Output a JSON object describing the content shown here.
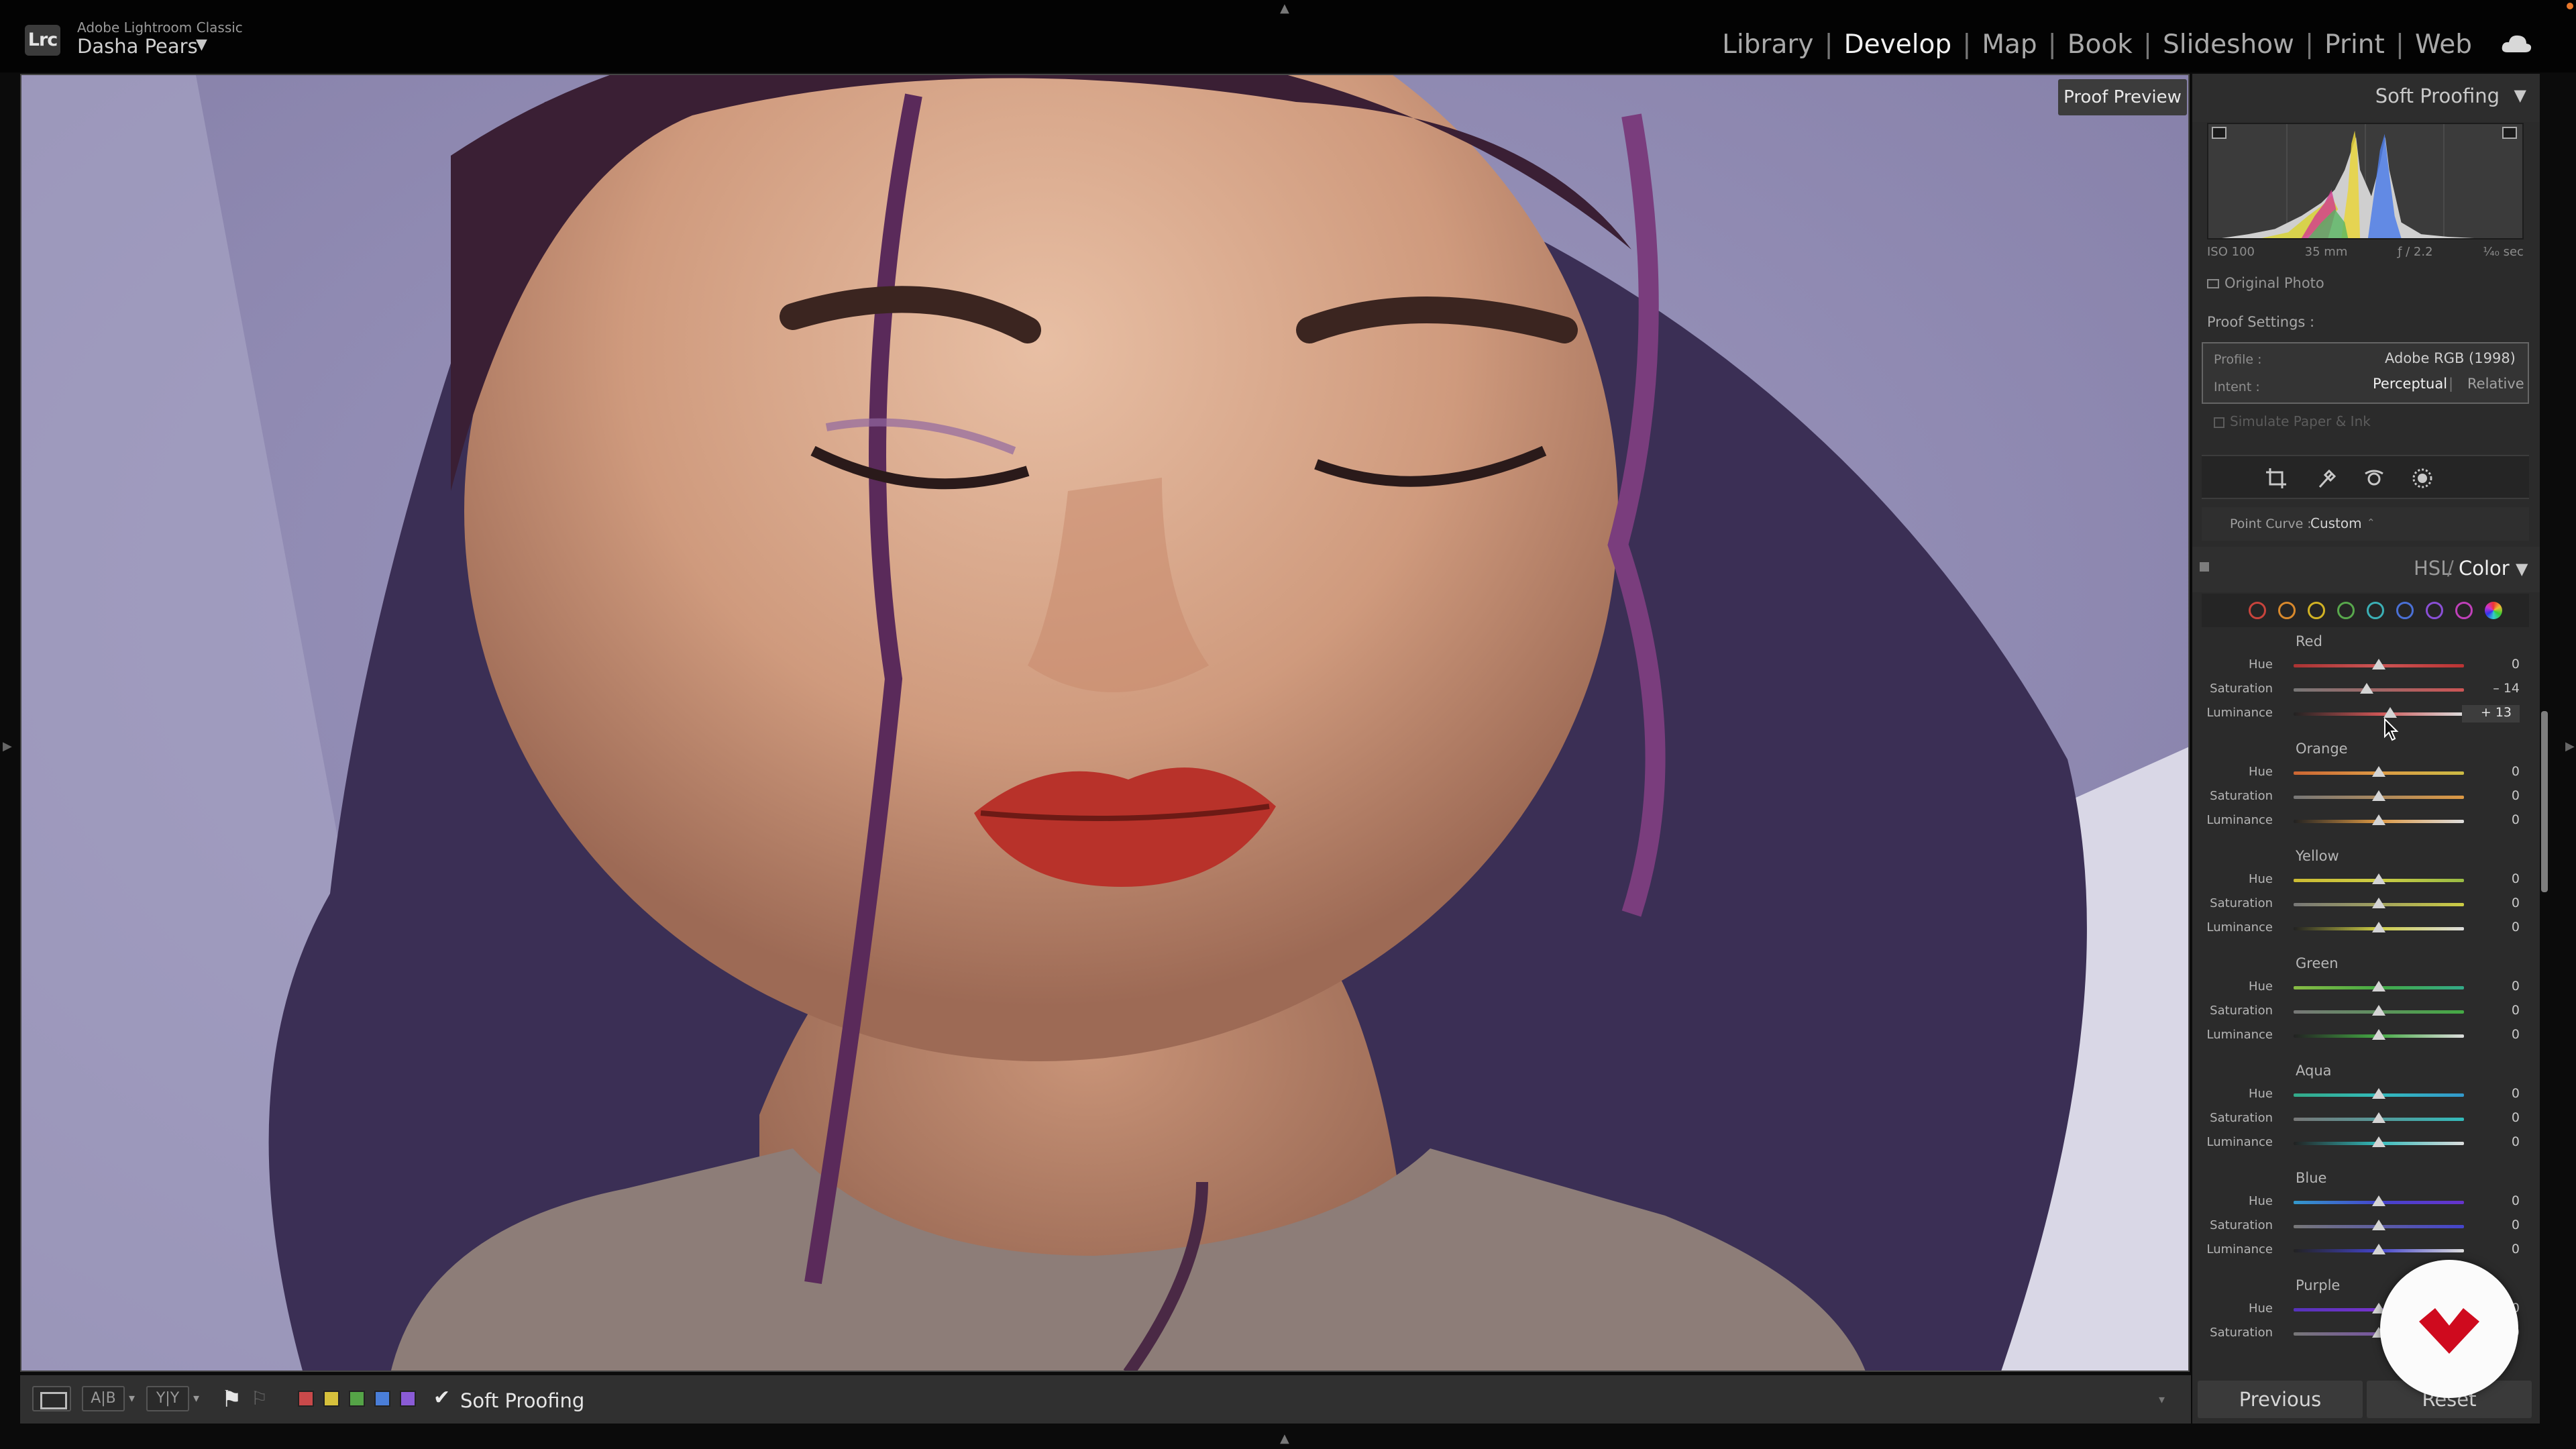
{
  "app": {
    "name": "Adobe Lightroom Classic",
    "logo_text": "Lrc",
    "user": "Dasha Pears",
    "user_arrow": "▼"
  },
  "modules": [
    "Library",
    "Develop",
    "Map",
    "Book",
    "Slideshow",
    "Print",
    "Web"
  ],
  "active_module": "Develop",
  "module_separator": "|",
  "image": {
    "proof_preview_label": "Proof Preview"
  },
  "toolbar": {
    "compare_label": "A|B",
    "survey_label": "Y|Y",
    "dropdown_arrow": "▾",
    "color_label_colors": [
      "#c9494a",
      "#d6c03c",
      "#55a447",
      "#4a7ed8",
      "#8a5bd6"
    ],
    "soft_proofing_checked": true,
    "soft_proofing_label": "Soft Proofing",
    "check_glyph": "✔",
    "collapse_arrow": "▾"
  },
  "panel": {
    "soft_proofing_title": "Soft Proofing",
    "triangle": "▼",
    "histogram_info": {
      "iso": "ISO 100",
      "focal": "35 mm",
      "aperture": "ƒ / 2.2",
      "shutter": "⅟₄₀ sec"
    },
    "original_photo_label": "Original Photo",
    "proof_settings_label": "Proof Settings :",
    "profile_label": "Profile :",
    "profile_value": "Adobe RGB (1998)",
    "intent_label": "Intent :",
    "intent_perceptual": "Perceptual",
    "intent_relative": "Relative",
    "intent_separator": "|",
    "simulate_label": "Simulate Paper & Ink",
    "tool_icons": [
      "crop-icon",
      "spot-removal-icon",
      "red-eye-icon",
      "masking-icon"
    ],
    "point_curve_label": "Point Curve :",
    "point_curve_value": "Custom",
    "point_curve_arrow": "⌃",
    "hsl_label": "HSL",
    "hsl_separator": "/",
    "color_label": "Color",
    "color_targets": [
      "#c9443c",
      "#d9892c",
      "#d2b324",
      "#58a84c",
      "#3bb0b6",
      "#4a70d6",
      "#8a4fd6",
      "#c040b9"
    ],
    "sections": [
      {
        "name": "Red",
        "rows": [
          {
            "label": "Hue",
            "value": "0",
            "pos": 0.5
          },
          {
            "label": "Saturation",
            "value": "– 14",
            "pos": 0.43
          },
          {
            "label": "Luminance",
            "value": "+ 13",
            "pos": 0.565,
            "editing": true
          }
        ]
      },
      {
        "name": "Orange",
        "rows": [
          {
            "label": "Hue",
            "value": "0",
            "pos": 0.5
          },
          {
            "label": "Saturation",
            "value": "0",
            "pos": 0.5
          },
          {
            "label": "Luminance",
            "value": "0",
            "pos": 0.5
          }
        ]
      },
      {
        "name": "Yellow",
        "rows": [
          {
            "label": "Hue",
            "value": "0",
            "pos": 0.5
          },
          {
            "label": "Saturation",
            "value": "0",
            "pos": 0.5
          },
          {
            "label": "Luminance",
            "value": "0",
            "pos": 0.5
          }
        ]
      },
      {
        "name": "Green",
        "rows": [
          {
            "label": "Hue",
            "value": "0",
            "pos": 0.5
          },
          {
            "label": "Saturation",
            "value": "0",
            "pos": 0.5
          },
          {
            "label": "Luminance",
            "value": "0",
            "pos": 0.5
          }
        ]
      },
      {
        "name": "Aqua",
        "rows": [
          {
            "label": "Hue",
            "value": "0",
            "pos": 0.5
          },
          {
            "label": "Saturation",
            "value": "0",
            "pos": 0.5
          },
          {
            "label": "Luminance",
            "value": "0",
            "pos": 0.5
          }
        ]
      },
      {
        "name": "Blue",
        "rows": [
          {
            "label": "Hue",
            "value": "0",
            "pos": 0.5
          },
          {
            "label": "Saturation",
            "value": "0",
            "pos": 0.5
          },
          {
            "label": "Luminance",
            "value": "0",
            "pos": 0.5
          }
        ]
      },
      {
        "name": "Purple",
        "rows": [
          {
            "label": "Hue",
            "value": "0",
            "pos": 0.5
          },
          {
            "label": "Saturation",
            "value": "0",
            "pos": 0.5
          }
        ]
      }
    ],
    "previous_label": "Previous",
    "reset_label": "Reset"
  },
  "colors": {
    "accent_logo": "#cf0a1e",
    "background": "#0b0b0b",
    "panel": "#2b2b2b"
  }
}
